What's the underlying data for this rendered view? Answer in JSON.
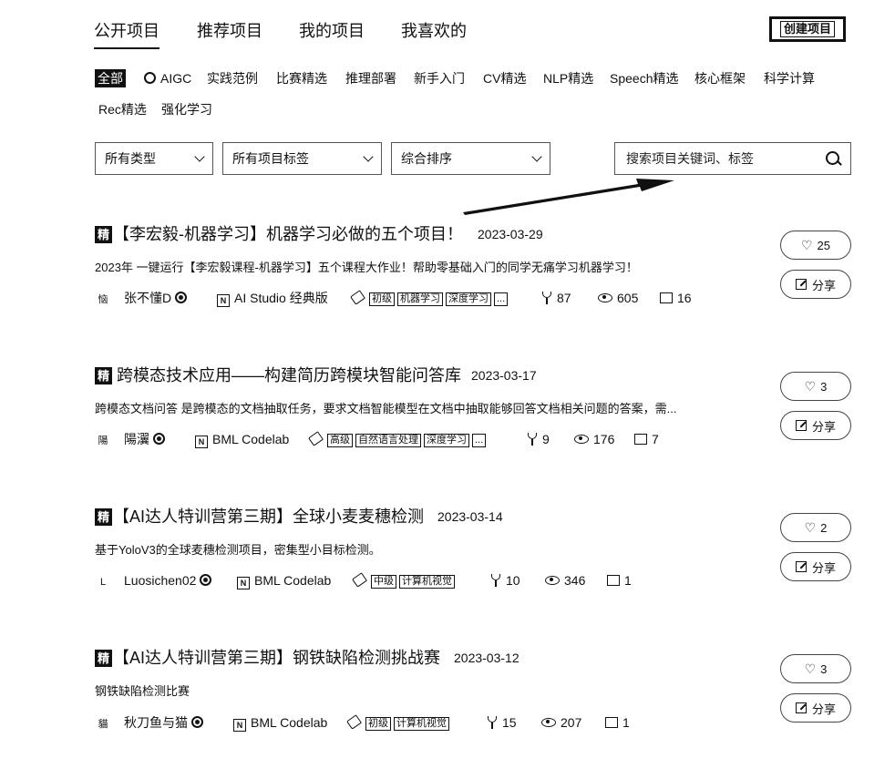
{
  "top_tabs": [
    "公开项目",
    "推荐项目",
    "我的项目",
    "我喜欢的"
  ],
  "create_label": "创建项目",
  "categories": [
    "全部",
    "AIGC",
    "实践范例",
    "比赛精选",
    "推理部署",
    "新手入门",
    "CV精选",
    "NLP精选",
    "Speech精选",
    "核心框架",
    "科学计算",
    "Rec精选",
    "强化学习"
  ],
  "filters": {
    "type": "所有类型",
    "tags": "所有项目标签",
    "sort": "综合排序"
  },
  "search": {
    "placeholder": "搜索项目关键词、标签"
  },
  "badge_label": "精",
  "share_label": "分享",
  "projects": [
    {
      "title": "【李宏毅-机器学习】机器学习必做的五个项目！",
      "date": "2023-03-29",
      "desc": "2023年 一键运行【李宏毅课程-机器学习】五个课程大作业！帮助零基础入门的同学无痛学习机器学习！",
      "author": "张不懂D",
      "avatar": "恼",
      "env": "AI Studio 经典版",
      "tags": [
        "初级",
        "机器学习",
        "深度学习",
        "..."
      ],
      "forks": "87",
      "views": "605",
      "comments": "16",
      "likes": "25"
    },
    {
      "title": "跨模态技术应用——构建简历跨模块智能问答库",
      "date": "2023-03-17",
      "desc": "跨模态文档问答 是跨模态的文档抽取任务，要求文档智能模型在文档中抽取能够回答文档相关问题的答案，需...",
      "author": "陽瀷",
      "avatar": "陽",
      "env": "BML Codelab",
      "tags": [
        "高级",
        "自然语言处理",
        "深度学习",
        "..."
      ],
      "forks": "9",
      "views": "176",
      "comments": "7",
      "likes": "3"
    },
    {
      "title": "【AI达人特训营第三期】全球小麦麦穗检测",
      "date": "2023-03-14",
      "desc": "基于YoloV3的全球麦穗检测项目，密集型小目标检测。",
      "author": "Luosichen02",
      "avatar": "L",
      "env": "BML Codelab",
      "tags": [
        "中级",
        "计算机视觉"
      ],
      "forks": "10",
      "views": "346",
      "comments": "1",
      "likes": "2"
    },
    {
      "title": "【AI达人特训营第三期】钢铁缺陷检测挑战赛",
      "date": "2023-03-12",
      "desc": "钢铁缺陷检测比赛",
      "author": "秋刀鱼与猫",
      "avatar": "貓",
      "env": "BML Codelab",
      "tags": [
        "初级",
        "计算机视觉"
      ],
      "forks": "15",
      "views": "207",
      "comments": "1",
      "likes": "3"
    }
  ]
}
